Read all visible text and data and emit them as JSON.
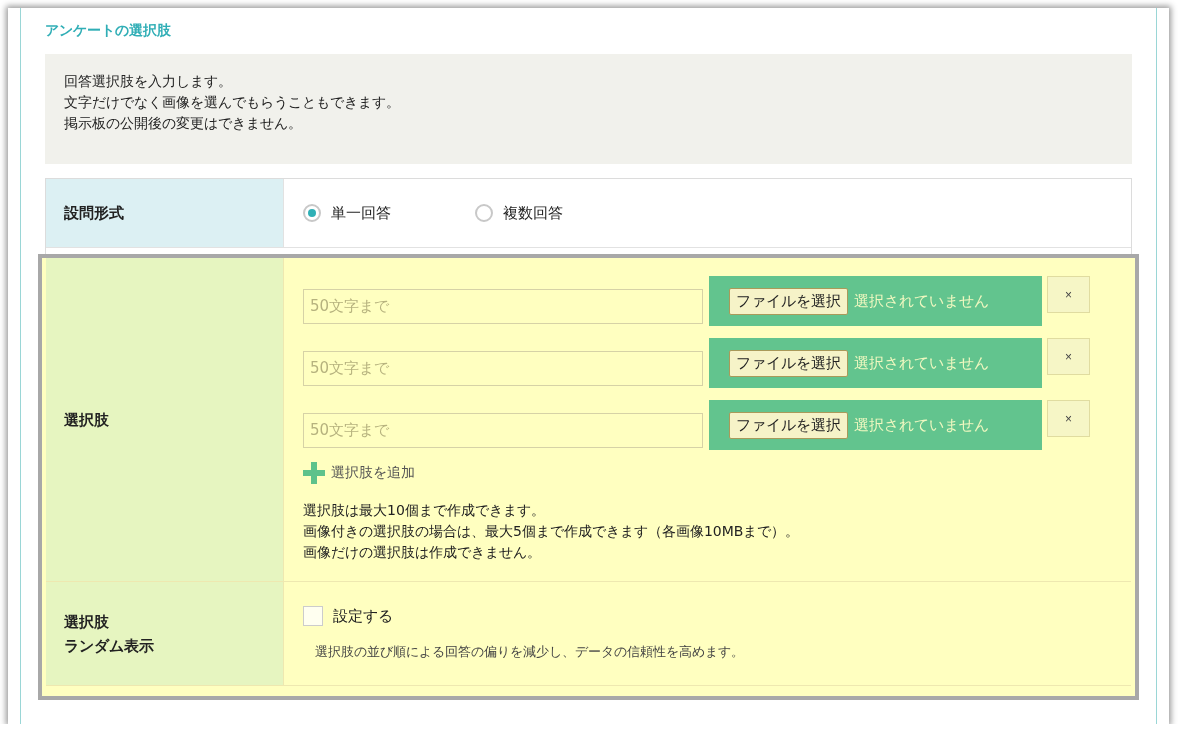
{
  "section_title": "アンケートの選択肢",
  "notice": {
    "lines": [
      "回答選択肢を入力します。",
      "文字だけでなく画像を選んでもらうこともできます。",
      "掲示板の公開後の変更はできません。"
    ]
  },
  "rows": [
    {
      "kind": "radio",
      "highlighted": false,
      "label_lines": [
        "設問形式"
      ],
      "options": [
        {
          "label": "単一回答",
          "selected": true
        },
        {
          "label": "複数回答",
          "selected": false
        }
      ]
    },
    {
      "kind": "choices",
      "highlighted": true,
      "label_lines": [
        "選択肢"
      ],
      "choices": [
        {
          "placeholder": "50文字まで",
          "file_button": "ファイルを選択",
          "file_status": "選択されていません",
          "remove": "×"
        },
        {
          "placeholder": "50文字まで",
          "file_button": "ファイルを選択",
          "file_status": "選択されていません",
          "remove": "×"
        },
        {
          "placeholder": "50文字まで",
          "file_button": "ファイルを選択",
          "file_status": "選択されていません",
          "remove": "×"
        }
      ],
      "add_label": "選択肢を追加",
      "notes": [
        "選択肢は最大10個まで作成できます。",
        "画像付きの選択肢の場合は、最大5個まで作成できます（各画像10MBまで）。",
        "画像だけの選択肢は作成できません。"
      ]
    },
    {
      "kind": "checkbox",
      "highlighted": true,
      "label_lines": [
        "選択肢",
        "ランダム表示"
      ],
      "checkbox": {
        "label": "設定する",
        "checked": false
      },
      "hint": "選択肢の並び順による回答の偏りを減少し、データの信頼性を高めます。"
    }
  ]
}
